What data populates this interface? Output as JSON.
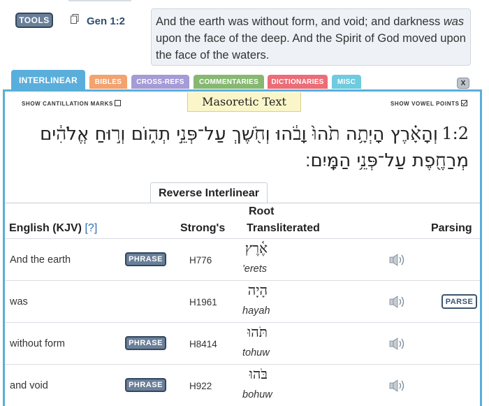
{
  "header": {
    "tools_label": "TOOLS",
    "reference": "Gen 1:2",
    "verse_part1": "And the earth was without form, and void; and darkness ",
    "verse_italic": "was",
    "verse_part2": " upon the face of the deep. And the Spirit of God moved upon the face of the waters."
  },
  "tabs": {
    "interlinear": "INTERLINEAR",
    "bibles": "BIBLES",
    "crossrefs": "CROSS-REFS",
    "commentaries": "COMMENTARIES",
    "dictionaries": "DICTIONARIES",
    "misc": "MISC",
    "close": "X"
  },
  "panel": {
    "show_cantillation": "SHOW CANTILLATION MARKS",
    "masoretic_title": "Masoretic Text",
    "show_vowel": "SHOW VOWEL POINTS",
    "verse_number": "1:2",
    "hebrew_line1": "וְהָאָ֗רֶץ הָיְתָ֥ה תֹ֙הוּ֙ וָבֹ֔הוּ וְחֹ֖שֶׁךְ עַל־פְּנֵ֣י תְה֑וֹם וְר֣וּחַ אֱלֹהִ֔ים",
    "hebrew_line2": "מְרַחֶ֖פֶת עַל־פְּנֵ֥י הַמָּֽיִם׃",
    "reverse_tab": "Reverse Interlinear"
  },
  "table": {
    "headers": {
      "english": "English (KJV)",
      "help": "[?]",
      "strongs": "Strong's",
      "root": "Root",
      "transliterated": "Transliterated",
      "parsing": "Parsing"
    },
    "rows": [
      {
        "english": "And the earth",
        "button": "PHRASE",
        "strongs": "H776",
        "hebrew": "אֶ֫רֶץ",
        "translit": "'erets"
      },
      {
        "english": "was",
        "button": "PARSE",
        "strongs": "H1961",
        "hebrew": "הָיָה",
        "translit": "hayah"
      },
      {
        "english": "without form",
        "button": "PHRASE",
        "strongs": "H8414",
        "hebrew": "תֹּהוּ",
        "translit": "tohuw"
      },
      {
        "english": "and void",
        "button": "PHRASE",
        "strongs": "H922",
        "hebrew": "בֹּהוּ",
        "translit": "bohuw"
      }
    ]
  },
  "colors": {
    "tab_interlinear": "#5aaedb",
    "tab_bibles": "#f2a36f",
    "tab_crossrefs": "#a59bd6",
    "tab_commentaries": "#87b872",
    "tab_dictionaries": "#ea6d77",
    "tab_misc": "#6fcbe0",
    "button_blue": "#6a7f98"
  }
}
